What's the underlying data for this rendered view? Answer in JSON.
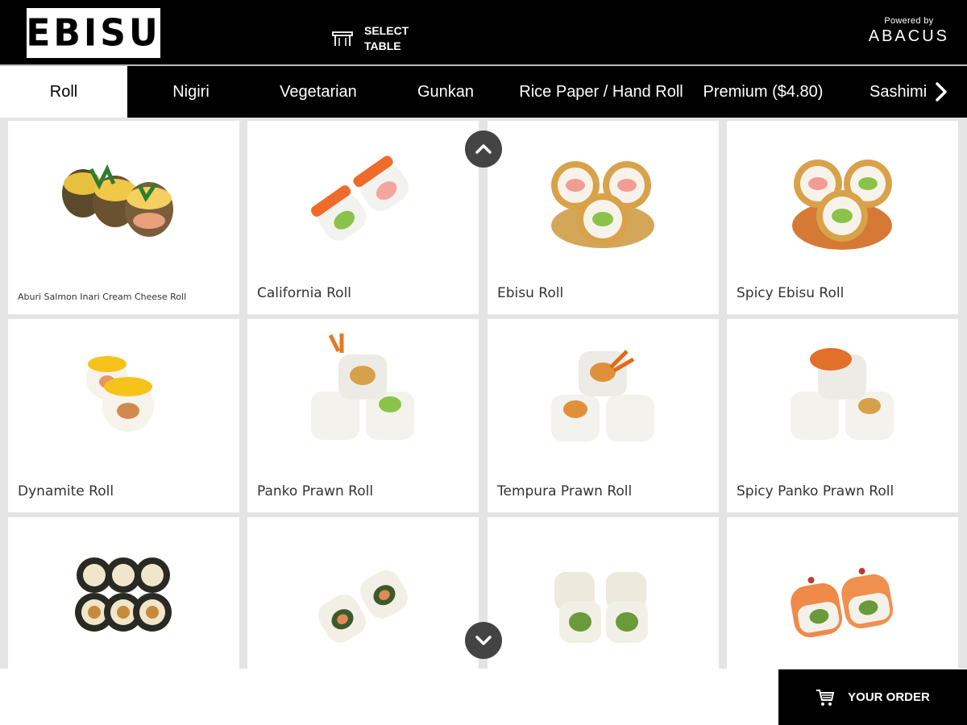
{
  "header": {
    "logo_text": "EBISU",
    "select_table_line1": "SELECT",
    "select_table_line2": "TABLE",
    "powered_by": "Powered by",
    "powered_brand": "ABACUS"
  },
  "tabs": [
    {
      "label": "Roll",
      "active": true
    },
    {
      "label": "Nigiri"
    },
    {
      "label": "Vegetarian"
    },
    {
      "label": "Gunkan"
    },
    {
      "label": "Rice Paper / Hand Roll"
    },
    {
      "label": "Premium ($4.80)"
    },
    {
      "label": "Sashimi"
    }
  ],
  "items": [
    {
      "name": "Aburi Salmon Inari Cream Cheese Roll",
      "icon": "aburi-roll-photo"
    },
    {
      "name": "California Roll",
      "icon": "california-roll-photo"
    },
    {
      "name": "Ebisu Roll",
      "icon": "ebisu-roll-photo"
    },
    {
      "name": "Spicy Ebisu Roll",
      "icon": "spicy-ebisu-roll-photo"
    },
    {
      "name": "Dynamite Roll",
      "icon": "dynamite-roll-photo"
    },
    {
      "name": "Panko Prawn Roll",
      "icon": "panko-prawn-roll-photo"
    },
    {
      "name": "Tempura Prawn Roll",
      "icon": "tempura-prawn-roll-photo"
    },
    {
      "name": "Spicy Panko Prawn Roll",
      "icon": "spicy-panko-prawn-roll-photo"
    },
    {
      "name": "",
      "icon": "seaweed-roll-photo"
    },
    {
      "name": "",
      "icon": "sesame-roll-photo"
    },
    {
      "name": "",
      "icon": "cucumber-roll-photo"
    },
    {
      "name": "",
      "icon": "salmon-roll-photo"
    }
  ],
  "footer": {
    "order_label": "YOUR ORDER"
  },
  "colors": {
    "bar": "#000000",
    "grid_bg": "#e4e4e4",
    "scroll_btn": "#444444"
  }
}
